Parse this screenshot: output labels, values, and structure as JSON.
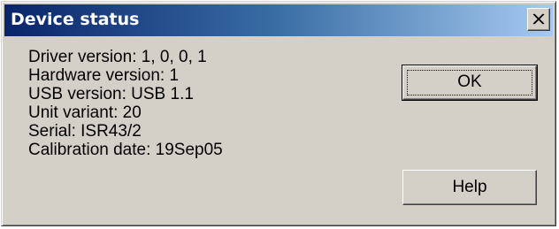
{
  "window": {
    "title": "Device status"
  },
  "status": {
    "lines": [
      "Driver version: 1, 0, 0, 1",
      "Hardware version: 1",
      "USB version: USB 1.1",
      "Unit variant: 20",
      "Serial: ISR43/2",
      "Calibration date: 19Sep05"
    ]
  },
  "buttons": {
    "ok_label": "OK",
    "help_label": "Help"
  },
  "icons": {
    "close": "close-icon"
  },
  "colors": {
    "titlebar_start": "#0a246a",
    "titlebar_end": "#a6caf0",
    "dialog_face": "#d4d0c8"
  }
}
